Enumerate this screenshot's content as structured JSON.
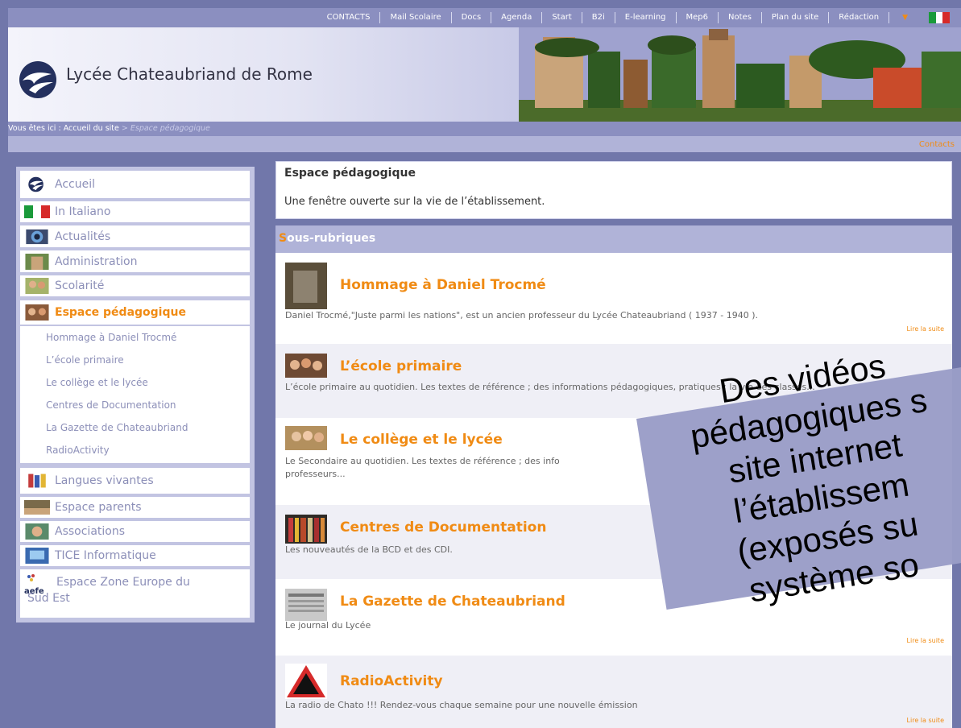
{
  "topnav": {
    "items": [
      "CONTACTS",
      "Mail Scolaire",
      "Docs",
      "Agenda",
      "Start",
      "B2i",
      "E-learning",
      "Mep6",
      "Notes",
      "Plan du site",
      "Rédaction"
    ],
    "arrow": "▼"
  },
  "header": {
    "title": "Lycée Chateaubriand de Rome"
  },
  "breadcrumb": {
    "prefix": "Vous êtes ici : Accueil du site",
    "separator": " > ",
    "current": "Espace pédagogique"
  },
  "contacts_link": "Contacts",
  "sidebar": {
    "items": [
      {
        "label": "Accueil"
      },
      {
        "label": "In Italiano"
      },
      {
        "label": "Actualités"
      },
      {
        "label": "Administration"
      },
      {
        "label": "Scolarité"
      },
      {
        "label": "Espace pédagogique"
      },
      {
        "label": "Langues vivantes"
      },
      {
        "label": "Espace parents"
      },
      {
        "label": "Associations"
      },
      {
        "label": "TICE Informatique"
      },
      {
        "label": "Espace Zone Europe du Sud Est"
      }
    ],
    "subitems": [
      "Hommage à Daniel Trocmé",
      "L’école primaire",
      "Le collège et le lycée",
      "Centres de Documentation",
      "La Gazette de Chateaubriand",
      "RadioActivity"
    ],
    "aefe": "aefe"
  },
  "main": {
    "heading": "Espace pédagogique",
    "description": "Une fenêtre ouverte sur la vie de l’établissement.",
    "subheading": "Sous-rubriques",
    "read_more": "Lire la suite",
    "entries": [
      {
        "title": "Hommage à Daniel Trocmé",
        "desc": "Daniel Trocmé,\"Juste parmi les nations\", est un ancien professeur du Lycée Chateaubriand ( 1937 - 1940 )."
      },
      {
        "title": "L’école primaire",
        "desc": "L’école primaire au quotidien. Les textes de référence ; des informations pédagogiques, pratiques ; la vie des classes..."
      },
      {
        "title": "Le collège et le lycée",
        "desc": "Le Secondaire au quotidien. Les textes de référence ; des info",
        "desc2": "professeurs..."
      },
      {
        "title": "Centres de Documentation",
        "desc": "Les nouveautés de la BCD et des CDI."
      },
      {
        "title": "La Gazette de Chateaubriand",
        "desc": "Le journal du Lycée"
      },
      {
        "title": "RadioActivity",
        "desc": "La radio de Chato !!! Rendez-vous chaque semaine pour une nouvelle émission"
      }
    ]
  },
  "overlay": {
    "lines": [
      "Des vidéos",
      "pédagogiques s",
      "site internet",
      "l’établissem",
      "(exposés su",
      "système so"
    ]
  },
  "colors": {
    "accent": "#f08b14",
    "nav": "#8b8fc0",
    "background": "#7177aa"
  }
}
